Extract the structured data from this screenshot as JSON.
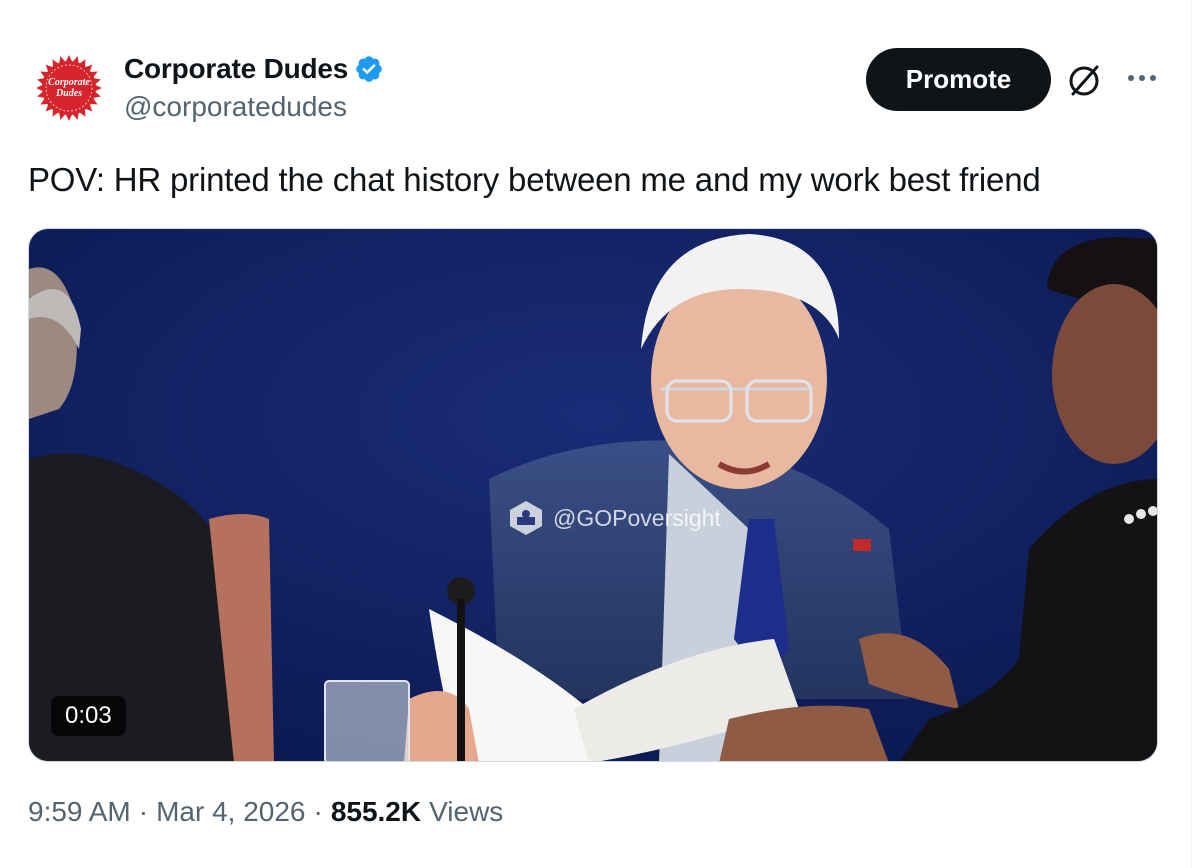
{
  "tweet": {
    "avatar": {
      "text_line1": "Corporate",
      "text_line2": "Dudes",
      "color": "#d6242c"
    },
    "author": {
      "display_name": "Corporate Dudes",
      "handle": "@corporatedudes",
      "verified": true,
      "verified_color": "#1d9bf0"
    },
    "actions": {
      "promote_label": "Promote",
      "grok_icon": "grok-icon",
      "more_icon": "more-icon"
    },
    "text": "POV: HR printed the chat history between me and my work best friend",
    "media": {
      "type": "video",
      "watermark": "@GOPoversight",
      "duration": "0:03"
    },
    "meta": {
      "time": "9:59 AM",
      "separator": "·",
      "date": "Mar 4, 2026",
      "views_count": "855.2K",
      "views_label": "Views"
    }
  }
}
